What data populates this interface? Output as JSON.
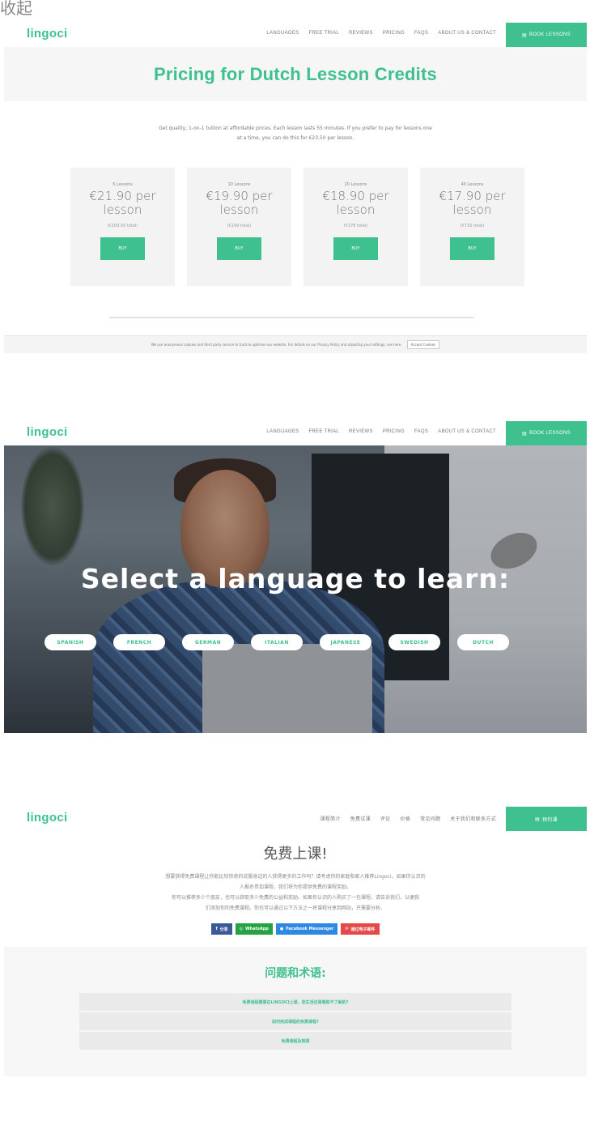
{
  "corner_text": "收起",
  "brand": {
    "logo": "lingoci",
    "accent": "#3fc08f"
  },
  "nav_en": {
    "items": [
      "LANGUAGES",
      "FREE TRIAL",
      "REVIEWS",
      "PRICING",
      "FAQS",
      "ABOUT US & CONTACT"
    ],
    "book": "BOOK LESSONS"
  },
  "pricing": {
    "title": "Pricing for Dutch Lesson Credits",
    "intro_1": "Get quality, 1-on-1 tuition at affordable prices. Each lesson lasts 55 minutes. If you prefer to pay for lessons one",
    "intro_2": "at a time, you can do this for €23.50 per lesson.",
    "cards": [
      {
        "count": "5 Lessons",
        "price_line1": "€21.90 per",
        "price_line2": "lesson",
        "total": "(€109.50 total)",
        "buy": "BUY"
      },
      {
        "count": "10 Lessons",
        "price_line1": "€19.90 per",
        "price_line2": "lesson",
        "total": "(€199 total)",
        "buy": "BUY"
      },
      {
        "count": "20 Lessons",
        "price_line1": "€18.90 per",
        "price_line2": "lesson",
        "total": "(€378 total)",
        "buy": "BUY"
      },
      {
        "count": "40 Lessons",
        "price_line1": "€17.90 per",
        "price_line2": "lesson",
        "total": "(€716 total)",
        "buy": "BUY"
      }
    ],
    "cookie_text": "We use anonymous cookies and third party service to track & optimise our website. For details on our Privacy Policy and adjusting your settings, see here.",
    "cookie_button": "Accept Cookies"
  },
  "languages_hero": {
    "title": "Select a language to learn:",
    "languages": [
      "SPANISH",
      "FRENCH",
      "GERMAN",
      "ITALIAN",
      "JAPANESE",
      "SWEDISH",
      "DUTCH"
    ]
  },
  "nav_zh": {
    "items": [
      "课程简介",
      "免费试课",
      "评论",
      "价格",
      "常见问题",
      "关于我们和联系方式"
    ],
    "book": "预约课"
  },
  "free_lesson": {
    "title": "免费上课!",
    "text_1": "想要获得免费课程让你能比较惊奇的说服身边的人获得更多的工作吗？请考虑你的家庭和家人推荐Lingoci，如果你认识的",
    "text_2": "人报名参加课程，我们将为你提供免费的课程奖励。",
    "text_3": "你可以推荐多少个朋友，也可以获取多少免费的公益和奖励。如果你认识的人购买了一包课程，请告诉我们，以便我",
    "text_4": "们添加你的免费课程。你也可以通过以下方法之一将课程分享到网站，只需要分析。",
    "share": [
      {
        "label": "分享",
        "icon": "facebook-f-icon",
        "color": "#3b5998"
      },
      {
        "label": "WhatsApp",
        "icon": "whatsapp-icon",
        "color": "#25a244"
      },
      {
        "label": "Facebook Messenger",
        "icon": "messenger-icon",
        "color": "#2d88e3"
      },
      {
        "label": "通过电子邮件",
        "icon": "mail-icon",
        "color": "#e54848"
      }
    ]
  },
  "faq": {
    "title": "问题和术语:",
    "items": [
      "免费课程需要在LINGOCI上课，您生活还是哪些不了解的?",
      "如何完成课程的免费课程?",
      "免费课程及规则"
    ]
  }
}
